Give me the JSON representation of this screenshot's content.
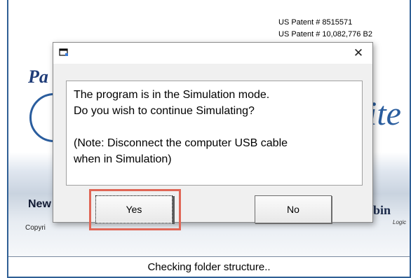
{
  "background_window": {
    "patents": [
      "US Patent # 8515571",
      "US Patent # 10,082,776 B2"
    ],
    "partial_title_text": "Pa",
    "partial_brand_text": "ite",
    "partial_heading_text": "New",
    "partial_copyright_text": "Copyri",
    "partial_logo_text": "bin",
    "partial_logo_sub": "Logic",
    "status_text": "Checking folder structure.."
  },
  "dialog": {
    "title": "",
    "close_glyph": "✕",
    "message_lines": [
      "The program is in the Simulation mode.",
      "Do you wish to continue Simulating?",
      "(Note: Disconnect the computer USB cable",
      "when in Simulation)"
    ],
    "buttons": {
      "yes_label": "Yes",
      "no_label": "No"
    }
  },
  "colors": {
    "highlight": "#e06656",
    "frame": "#2f5f95",
    "brand_blue": "#2a5d9e"
  },
  "icons": {
    "title_icon": "app-window-icon",
    "close_icon": "close-icon"
  }
}
